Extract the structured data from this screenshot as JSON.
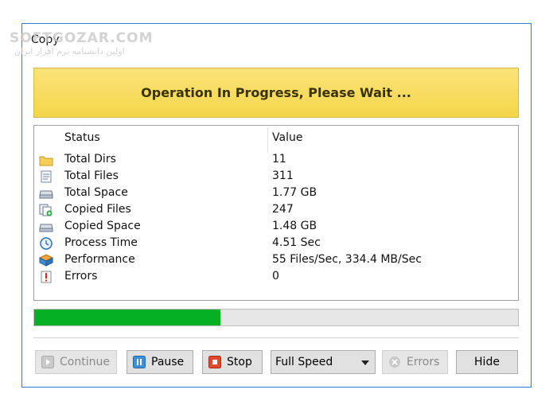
{
  "window": {
    "title": "Copy"
  },
  "watermark": {
    "line1": "SOFTGOZAR.COM",
    "line2": "اولین دانشنامه نرم افزار ایران"
  },
  "banner": {
    "text": "Operation In Progress, Please Wait ..."
  },
  "table": {
    "columns": {
      "status": "Status",
      "value": "Value"
    },
    "rows": [
      {
        "icon": "folder-icon",
        "label": "Total Dirs",
        "value": "11"
      },
      {
        "icon": "file-icon",
        "label": "Total Files",
        "value": "311"
      },
      {
        "icon": "drive-icon",
        "label": "Total Space",
        "value": "1.77 GB"
      },
      {
        "icon": "copied-files-icon",
        "label": "Copied Files",
        "value": "247"
      },
      {
        "icon": "drive-icon",
        "label": "Copied Space",
        "value": "1.48 GB"
      },
      {
        "icon": "clock-icon",
        "label": "Process Time",
        "value": "4.51 Sec"
      },
      {
        "icon": "performance-icon",
        "label": "Performance",
        "value": "55 Files/Sec, 334.4 MB/Sec"
      },
      {
        "icon": "error-icon",
        "label": "Errors",
        "value": "0"
      }
    ]
  },
  "progress": {
    "fraction": 0.385,
    "color": "#06b025"
  },
  "buttons": {
    "continue": "Continue",
    "pause": "Pause",
    "stop": "Stop",
    "speed": "Full Speed",
    "errors": "Errors",
    "hide": "Hide"
  }
}
